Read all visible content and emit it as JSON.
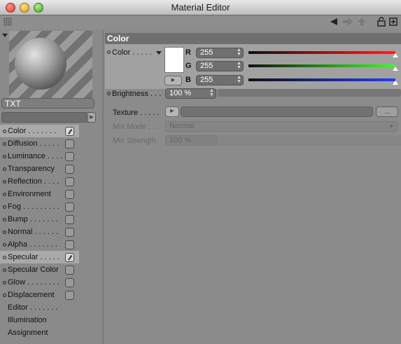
{
  "window": {
    "title": "Material Editor"
  },
  "toolbar": {
    "icons": [
      "grip-icon",
      "back-arrow-icon",
      "forward-arrow-icon",
      "up-arrow-icon",
      "lock-icon",
      "new-window-icon"
    ]
  },
  "preview": {
    "material_name": "TXT"
  },
  "channels": [
    {
      "label": "Color . . . . . . .",
      "checked": true,
      "selected": true,
      "has_checkbox": true,
      "has_dot": true
    },
    {
      "label": "Diffusion . . . . .",
      "checked": false,
      "selected": false,
      "has_checkbox": true,
      "has_dot": true
    },
    {
      "label": "Luminance . . . .",
      "checked": false,
      "selected": false,
      "has_checkbox": true,
      "has_dot": true
    },
    {
      "label": "Transparency",
      "checked": false,
      "selected": false,
      "has_checkbox": true,
      "has_dot": true
    },
    {
      "label": "Reflection . . . .",
      "checked": false,
      "selected": false,
      "has_checkbox": true,
      "has_dot": true
    },
    {
      "label": "Environment",
      "checked": false,
      "selected": false,
      "has_checkbox": true,
      "has_dot": true
    },
    {
      "label": "Fog . . . . . . . . .",
      "checked": false,
      "selected": false,
      "has_checkbox": true,
      "has_dot": true
    },
    {
      "label": "Bump . . . . . . .",
      "checked": false,
      "selected": false,
      "has_checkbox": true,
      "has_dot": true
    },
    {
      "label": "Normal . . . . . .",
      "checked": false,
      "selected": false,
      "has_checkbox": true,
      "has_dot": true
    },
    {
      "label": "Alpha . . . . . . .",
      "checked": false,
      "selected": false,
      "has_checkbox": true,
      "has_dot": true
    },
    {
      "label": "Specular . . . . .",
      "checked": true,
      "selected": true,
      "has_checkbox": true,
      "has_dot": true
    },
    {
      "label": "Specular Color",
      "checked": false,
      "selected": false,
      "has_checkbox": true,
      "has_dot": true
    },
    {
      "label": "Glow . . . . . . . .",
      "checked": false,
      "selected": false,
      "has_checkbox": true,
      "has_dot": true
    },
    {
      "label": "Displacement",
      "checked": false,
      "selected": false,
      "has_checkbox": true,
      "has_dot": true
    },
    {
      "label": "Editor . . . . . . .",
      "checked": false,
      "selected": false,
      "has_checkbox": false,
      "has_dot": false
    },
    {
      "label": "Illumination",
      "checked": false,
      "selected": false,
      "has_checkbox": false,
      "has_dot": false
    },
    {
      "label": "Assignment",
      "checked": false,
      "selected": false,
      "has_checkbox": false,
      "has_dot": false
    }
  ],
  "color_section": {
    "header": "Color",
    "color_label": "Color . . . . .",
    "swatch_color": "#ffffff",
    "r_label": "R",
    "r_value": "255",
    "g_label": "G",
    "g_value": "255",
    "b_label": "B",
    "b_value": "255",
    "r_gradient": [
      "#000000",
      "#ff0000"
    ],
    "g_gradient": [
      "#000000",
      "#00ff00"
    ],
    "b_gradient": [
      "#000000",
      "#0000ff"
    ],
    "brightness_label": "Brightness . . .",
    "brightness_value": "100 %",
    "texture_label": "Texture . . . . .",
    "texture_more": "...",
    "mix_mode_label": "Mix Mode . . .",
    "mix_mode_value": "Normal",
    "mix_strength_label": "Mix Strength",
    "mix_strength_value": "100 %"
  }
}
